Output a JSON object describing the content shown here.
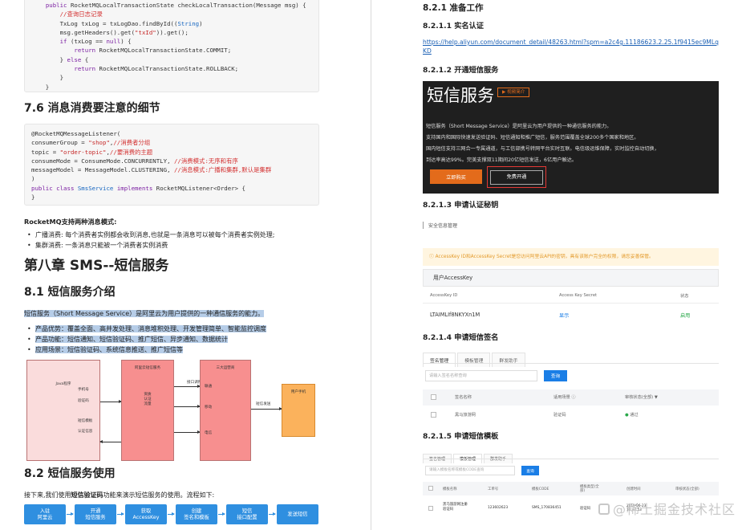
{
  "left": {
    "code1_lines": [
      [
        {
          "t": "    "
        },
        {
          "t": "public",
          "c": "kw"
        },
        {
          "t": " RocketMQLocalTransactionState checkLocalTransaction(Message msg) {"
        }
      ],
      [
        {
          "t": "        "
        },
        {
          "t": "//查询日志记录",
          "c": "cm"
        }
      ],
      [
        {
          "t": "        TxLog txLog = txLogDao.findById(("
        },
        {
          "t": "String",
          "c": "ty"
        },
        {
          "t": ")"
        }
      ],
      [
        {
          "t": "        msg.getHeaders().get("
        },
        {
          "t": "\"txId\"",
          "c": "str"
        },
        {
          "t": ")).get();"
        }
      ],
      [
        {
          "t": "        "
        },
        {
          "t": "if",
          "c": "kw"
        },
        {
          "t": " (txLog == "
        },
        {
          "t": "null",
          "c": "kw"
        },
        {
          "t": ") {"
        }
      ],
      [
        {
          "t": "            "
        },
        {
          "t": "return",
          "c": "kw"
        },
        {
          "t": " RocketMQLocalTransactionState.COMMIT;"
        }
      ],
      [
        {
          "t": "        } "
        },
        {
          "t": "else",
          "c": "kw"
        },
        {
          "t": " {"
        }
      ],
      [
        {
          "t": "            "
        },
        {
          "t": "return",
          "c": "kw"
        },
        {
          "t": " RocketMQLocalTransactionState.ROLLBACK;"
        }
      ],
      [
        {
          "t": "        }"
        }
      ],
      [
        {
          "t": "    }"
        }
      ]
    ],
    "section_76": "7.6 消息消费要注意的细节",
    "code2_lines": [
      [
        {
          "t": "@RocketMQMessageListener("
        }
      ],
      [
        {
          "t": "consumerGroup = "
        },
        {
          "t": "\"shop\"",
          "c": "str"
        },
        {
          "t": ","
        },
        {
          "t": "//消费者分组",
          "c": "cm"
        }
      ],
      [
        {
          "t": "topic = "
        },
        {
          "t": "\"order-topic\"",
          "c": "str"
        },
        {
          "t": ","
        },
        {
          "t": "//要消费的主题",
          "c": "cm"
        }
      ],
      [
        {
          "t": "consumeMode = ConsumeMode.CONCURRENTLY, "
        },
        {
          "t": "//消费模式:无序和有序",
          "c": "cm"
        }
      ],
      [
        {
          "t": "messageModel = MessageModel.CLUSTERING, "
        },
        {
          "t": "//消息模式:广播和集群,默认是集群",
          "c": "cm"
        }
      ],
      [
        {
          "t": ")"
        }
      ],
      [
        {
          "t": "public",
          "c": "kw"
        },
        {
          "t": " "
        },
        {
          "t": "class",
          "c": "kw"
        },
        {
          "t": " "
        },
        {
          "t": "SmsService",
          "c": "ty"
        },
        {
          "t": " "
        },
        {
          "t": "implements",
          "c": "kw"
        },
        {
          "t": " RocketMQListener<Order> {"
        }
      ],
      [
        {
          "t": "}"
        }
      ]
    ],
    "consume_modes_title": "RocketMQ支持两种消息模式:",
    "consume_modes": [
      "广播消费: 每个消费者实例都会收到消息,也就是一条消息可以被每个消费者实例处理;",
      "集群消费: 一条消息只能被一个消费者实例消费"
    ],
    "chapter_title": "第八章 SMS--短信服务",
    "section_81": "8.1 短信服务介绍",
    "intro": "短信服务（Short Message Service）是阿里云为用户提供的一种通信服务的能力。",
    "intro_bullets": [
      "产品优势：覆盖全面、高并发处理、消息堆积处理、开发管理简单、智能监控调度",
      "产品功能：短信通知、短信验证码、推广短信、异步通知、数据统计",
      "应用场景：短信验证码、系统信息推送、推广短信等"
    ],
    "diagram": {
      "java_box": "Java程序",
      "java_labels": [
        "手机号",
        "验证码",
        "短信模板",
        "认证信息"
      ],
      "aliyun_box": "阿里云短信服务",
      "aliyun_inner": [
        "资质",
        "认证",
        "流量"
      ],
      "interface_label": "接口调用",
      "carriers_box": "三大运营商",
      "carriers": [
        "联通",
        "移动",
        "电信"
      ],
      "send_label": "短信发送",
      "phone_box": "用户手机"
    },
    "section_82": "8.2 短信服务使用",
    "usage_intro_prefix": "接下来,我们使用",
    "usage_intro_bold": "短信验证码",
    "usage_intro_suffix": "功能来演示短信服务的使用。流程如下:",
    "flow_steps": [
      [
        "入驻",
        "阿里云"
      ],
      [
        "开通",
        "短信服务"
      ],
      [
        "获取",
        "AccessKey"
      ],
      [
        "创建",
        "签名和模板"
      ],
      [
        "短信",
        "接口配置"
      ],
      [
        "发送短信"
      ]
    ]
  },
  "right": {
    "h_821": "8.2.1 准备工作",
    "h_8211": "8.2.1.1 实名认证",
    "link": "https://help.aliyun.com/document_detail/48263.html?spm=a2c4g.11186623.2.25.1f9415ec9MLqKD",
    "h_8212": "8.2.1.2 开通短信服务",
    "banner": {
      "title": "短信服务",
      "video_btn": "▶ 视频简介",
      "desc_lines": [
        "短信服务（Short Message Service）是阿里云为用户提供的一种通信服务的能力。",
        "支持国内和国际快速发送验证码、短信通知和推广短信，服务范围覆盖全球200多个国家和地区。",
        "国内短信支持三网合一专属通道，与工信部携号转网平台实时互联。电信级运维保障，实时监控自动切换，",
        "到达率高达99%。完美支撑双11期间20亿短信发送，6亿用户触达。"
      ],
      "buy": "立即购买",
      "free": "免费开通"
    },
    "h_8213": "8.2.1.3 申请认证秘钥",
    "security_mgmt": "安全信息管理",
    "warning": "AccessKey ID和AccessKey Secret是您访问阿里云API的密钥，具有该账户完全的权限，请您妥善保管。",
    "ak_title": "用户AccessKey",
    "ak_columns": [
      "AccessKey ID",
      "Access Key Secret",
      "状态"
    ],
    "ak_row": {
      "id": "LTAIMLIf8NKYXn1M",
      "secret": "显示",
      "status": "启用"
    },
    "h_8214": "8.2.1.4 申请短信签名",
    "sign_tabs": [
      "签名管理",
      "模板管理",
      "群发助手"
    ],
    "sign_search_placeholder": "请输入签名名称查询",
    "query_btn": "查询",
    "sign_columns": [
      "签名名称",
      "适用场景 ⓘ",
      "审核状态(全部) ▼"
    ],
    "sign_row": {
      "name": "黑马旅游网",
      "scene": "验证码",
      "status": "通过"
    },
    "h_8215": "8.2.1.5 申请短信模板",
    "tpl_tabs": [
      "签名管理",
      "模板管理",
      "群发助手"
    ],
    "tpl_search_placeholder": "请输入模板名称或模板CODE查询",
    "tpl_columns": [
      "模板名称",
      "工单号",
      "模板CODE",
      "模板类型(全部)",
      "创建时间",
      "审核状态(全部)"
    ],
    "tpl_row": {
      "name": "黑马旅游网注册验证码",
      "ticket": "123602623",
      "code": "SMS_170836451",
      "type": "验证码",
      "time": "2019-06-23 12:44:53"
    }
  },
  "watermark": "@稀土掘金技术社区",
  "colors": {
    "flow_blue": "#2f8fe0",
    "link_blue": "#1a5fb4",
    "aliyun_orange": "#e36b1b",
    "highlight": "#b6cde8"
  }
}
